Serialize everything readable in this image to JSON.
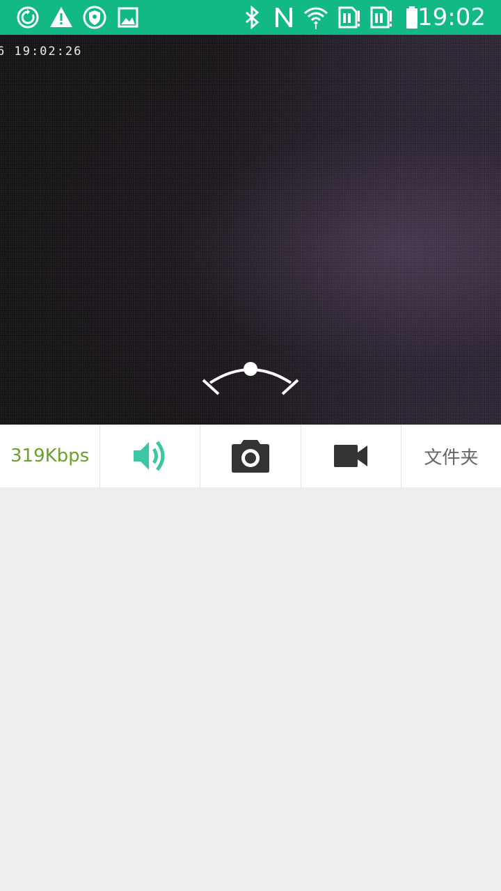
{
  "status_bar": {
    "time": "19:02",
    "background": "#12b886",
    "left_icons": [
      "sync-icon",
      "warning-icon",
      "shield-icon",
      "image-icon"
    ],
    "right_icons": [
      "bluetooth-icon",
      "nfc-icon",
      "wifi-icon",
      "sim1-icon",
      "sim2-icon",
      "battery-icon"
    ]
  },
  "video": {
    "osd_timestamp": "6 19:02:26",
    "ptz_control_icon": "ptz-arc-icon"
  },
  "toolbar": {
    "bitrate": "319Kbps",
    "bitrate_color": "#6aa12a",
    "audio_icon": "speaker-icon",
    "audio_color": "#3cc7a4",
    "snapshot_icon": "camera-icon",
    "record_icon": "video-camera-icon",
    "folder_label": "文件夹"
  }
}
